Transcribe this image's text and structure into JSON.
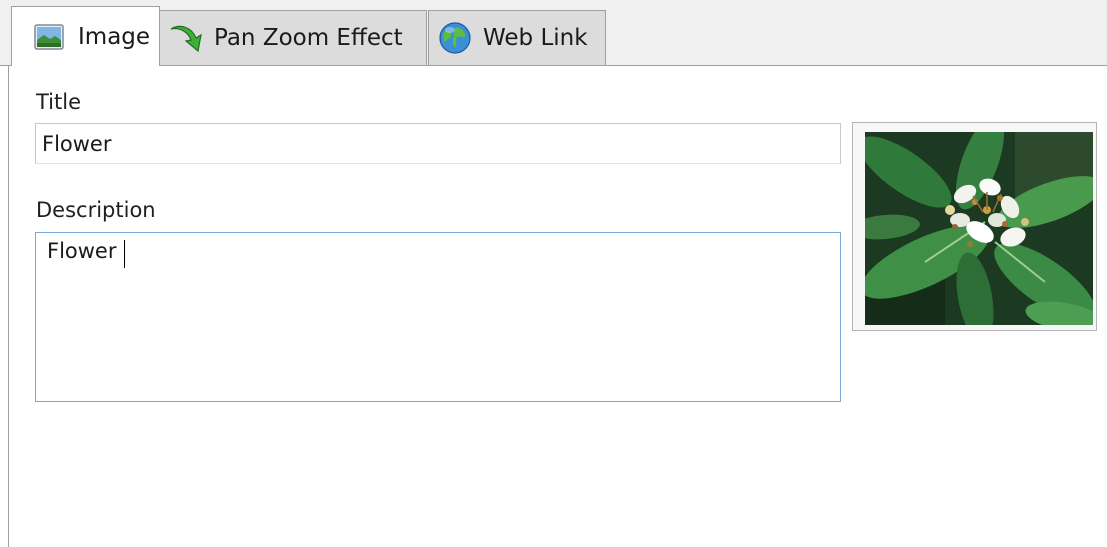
{
  "tabs": [
    {
      "label": "Image",
      "icon": "landscape-image-icon",
      "active": true
    },
    {
      "label": "Pan Zoom Effect",
      "icon": "green-arrow-icon",
      "active": false
    },
    {
      "label": "Web Link",
      "icon": "globe-icon",
      "active": false
    }
  ],
  "form": {
    "title_label": "Title",
    "title_value": "Flower",
    "description_label": "Description",
    "description_value": "Flower"
  },
  "preview": {
    "subject": "flower photo thumbnail"
  }
}
